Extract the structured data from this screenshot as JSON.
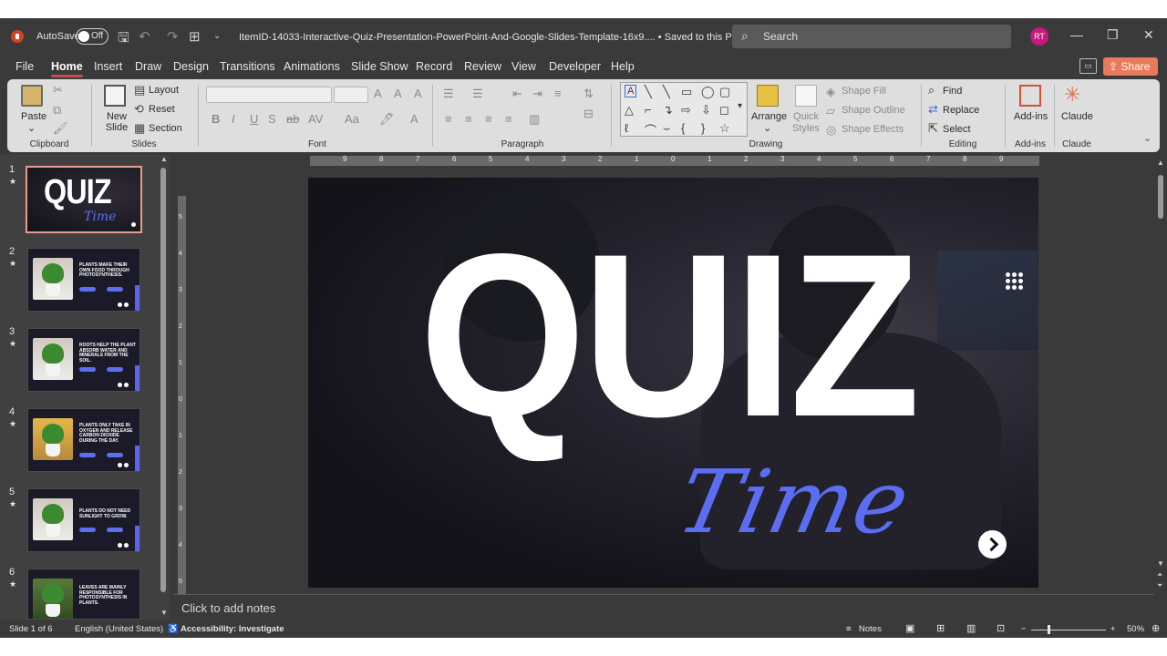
{
  "titlebar": {
    "autosave_label": "AutoSave",
    "autosave_state": "Off",
    "filename": "ItemID-14033-Interactive-Quiz-Presentation-PowerPoint-And-Google-Slides-Template-16x9....",
    "saved_status": "• Saved to this PC",
    "search_placeholder": "Search",
    "avatar_initials": "RT"
  },
  "tabs": [
    "File",
    "Home",
    "Insert",
    "Draw",
    "Design",
    "Transitions",
    "Animations",
    "Slide Show",
    "Record",
    "Review",
    "View",
    "Developer",
    "Help"
  ],
  "active_tab": "Home",
  "share_label": "Share",
  "ribbon": {
    "clipboard": {
      "paste": "Paste",
      "label": "Clipboard"
    },
    "slides": {
      "new_slide": "New Slide",
      "layout": "Layout",
      "reset": "Reset",
      "section": "Section",
      "label": "Slides"
    },
    "font": {
      "label": "Font"
    },
    "paragraph": {
      "label": "Paragraph"
    },
    "drawing": {
      "arrange": "Arrange",
      "quick_styles": "Quick Styles",
      "shape_fill": "Shape Fill",
      "shape_outline": "Shape Outline",
      "shape_effects": "Shape Effects",
      "label": "Drawing"
    },
    "editing": {
      "find": "Find",
      "replace": "Replace",
      "select": "Select",
      "label": "Editing"
    },
    "addins": {
      "button": "Add-ins",
      "label": "Add-ins"
    },
    "claude": {
      "button": "Claude",
      "label": "Claude"
    }
  },
  "thumbnails": [
    {
      "num": "1",
      "title": "QUIZ",
      "subtitle": "Time"
    },
    {
      "num": "2",
      "text": "Plants make their own food through photosynthesis."
    },
    {
      "num": "3",
      "text": "Roots help the plant absorb water and minerals from the soil."
    },
    {
      "num": "4",
      "text": "Plants only take in oxygen and release carbon dioxide during the day."
    },
    {
      "num": "5",
      "text": "Plants do not need sunlight to grow."
    },
    {
      "num": "6",
      "text": "Leaves are mainly responsible for photosynthesis in plants."
    }
  ],
  "slide": {
    "title": "QUIZ",
    "subtitle": "Time"
  },
  "notes_placeholder": "Click to add notes",
  "status": {
    "slide_count": "Slide 1 of 6",
    "language": "English (United States)",
    "accessibility": "Accessibility: Investigate",
    "notes": "Notes",
    "zoom": "50%"
  },
  "ruler_h": [
    "9",
    "8",
    "7",
    "6",
    "5",
    "4",
    "3",
    "2",
    "1",
    "0",
    "1",
    "2",
    "3",
    "4",
    "5",
    "6",
    "7",
    "8",
    "9"
  ],
  "ruler_v": [
    "5",
    "4",
    "3",
    "2",
    "1",
    "0",
    "1",
    "2",
    "3",
    "4",
    "5"
  ],
  "colors": {
    "accent": "#c0504d",
    "share": "#e8795a",
    "slide_blue": "#5b6ef2"
  }
}
